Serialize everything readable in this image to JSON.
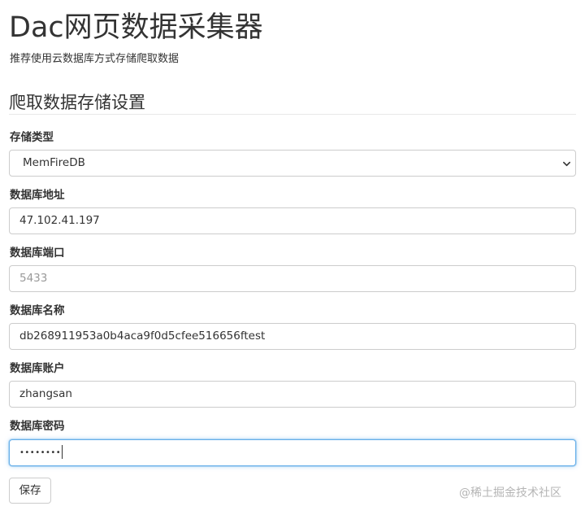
{
  "header": {
    "title": "Dac网页数据采集器",
    "subtitle": "推荐使用云数据库方式存储爬取数据"
  },
  "section": {
    "title": "爬取数据存储设置"
  },
  "form": {
    "storage_type": {
      "label": "存储类型",
      "value": "MemFireDB"
    },
    "db_address": {
      "label": "数据库地址",
      "value": "47.102.41.197"
    },
    "db_port": {
      "label": "数据库端口",
      "placeholder": "5433"
    },
    "db_name": {
      "label": "数据库名称",
      "value": "db268911953a0b4aca9f0d5cfee516656ftest"
    },
    "db_account": {
      "label": "数据库账户",
      "value": "zhangsan"
    },
    "db_password": {
      "label": "数据库密码",
      "masked_value": "••••••••"
    },
    "save_label": "保存"
  },
  "watermark": "@稀土掘金技术社区",
  "icons": {
    "select_caret": "chevron-down-icon"
  },
  "colors": {
    "focus_border": "#66afe9",
    "input_border": "#cccccc",
    "placeholder_text": "#999999",
    "watermark_text": "#b5b5b5"
  }
}
